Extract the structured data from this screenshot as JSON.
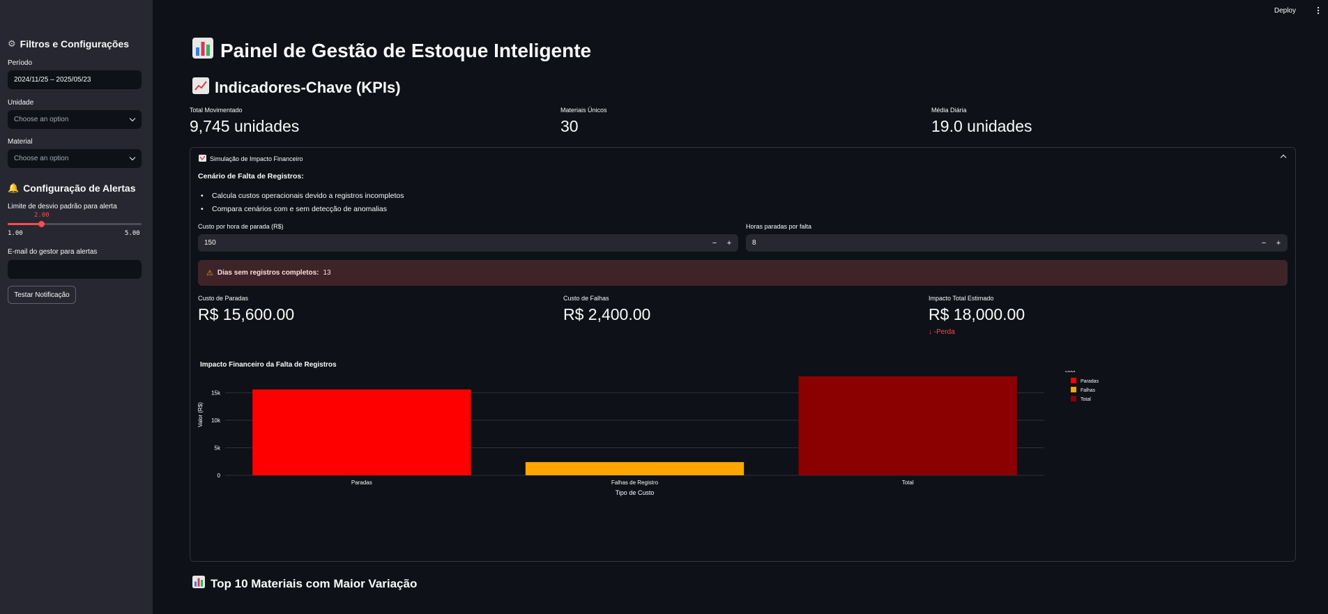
{
  "topbar": {
    "deploy_label": "Deploy"
  },
  "sidebar": {
    "filters_heading": "Filtros e Configurações",
    "period_label": "Período",
    "period_value": "2024/11/25 – 2025/05/23",
    "unit_label": "Unidade",
    "unit_placeholder": "Choose an option",
    "material_label": "Material",
    "material_placeholder": "Choose an option",
    "alerts_heading": "Configuração de Alertas",
    "slider_label": "Limite de desvio padrão para alerta",
    "slider_value": "2.00",
    "slider_min": "1.00",
    "slider_max": "5.00",
    "slider_fraction": 0.25,
    "email_label": "E-mail do gestor para alertas",
    "email_value": "",
    "test_button": "Testar Notificação"
  },
  "main": {
    "title": "Painel de Gestão de Estoque Inteligente",
    "kpi_heading": "Indicadores-Chave (KPIs)",
    "kpis": [
      {
        "label": "Total Movimentado",
        "value": "9,745 unidades"
      },
      {
        "label": "Materiais Únicos",
        "value": "30"
      },
      {
        "label": "Média Diária",
        "value": "19.0 unidades"
      }
    ],
    "expander": {
      "title": "Simulação de Impacto Financeiro",
      "scenario_heading": "Cenário de Falta de Registros:",
      "bullets": [
        "Calcula custos operacionais devido a registros incompletos",
        "Compara cenários com e sem detecção de anomalias"
      ],
      "cost_label": "Custo por hora de parada (R$)",
      "cost_value": "150",
      "hours_label": "Horas paradas por falta",
      "hours_value": "8",
      "warning_bold": "Dias sem registros completos:",
      "warning_value": "13",
      "metrics": [
        {
          "label": "Custo de Paradas",
          "value": "R$ 15,600.00"
        },
        {
          "label": "Custo de Falhas",
          "value": "R$ 2,400.00"
        },
        {
          "label": "Impacto Total Estimado",
          "value": "R$ 18,000.00",
          "delta": "-Perda"
        }
      ]
    },
    "top10_heading": "Top 10 Materiais com Maior Variação"
  },
  "colors": {
    "accent": "#ff4b4b",
    "paradas": "#ff0000",
    "falhas": "#ffa500",
    "total": "#8b0000"
  },
  "chart_data": {
    "type": "bar",
    "title": "Impacto Financeiro da Falta de Registros",
    "xlabel": "Tipo de Custo",
    "ylabel": "Valor (R$)",
    "categories": [
      "Paradas",
      "Falhas de Registro",
      "Total"
    ],
    "values": [
      15600,
      2400,
      18000
    ],
    "colors": [
      "#ff0000",
      "#ffa500",
      "#8b0000"
    ],
    "ylim": [
      0,
      19000
    ],
    "yticks": [
      0,
      5000,
      10000,
      15000
    ],
    "ytick_labels": [
      "0",
      "5k",
      "10k",
      "15k"
    ],
    "legend_title": "color",
    "legend": [
      "Paradas",
      "Falhas",
      "Total"
    ],
    "legend_position": "right",
    "grid": true
  }
}
